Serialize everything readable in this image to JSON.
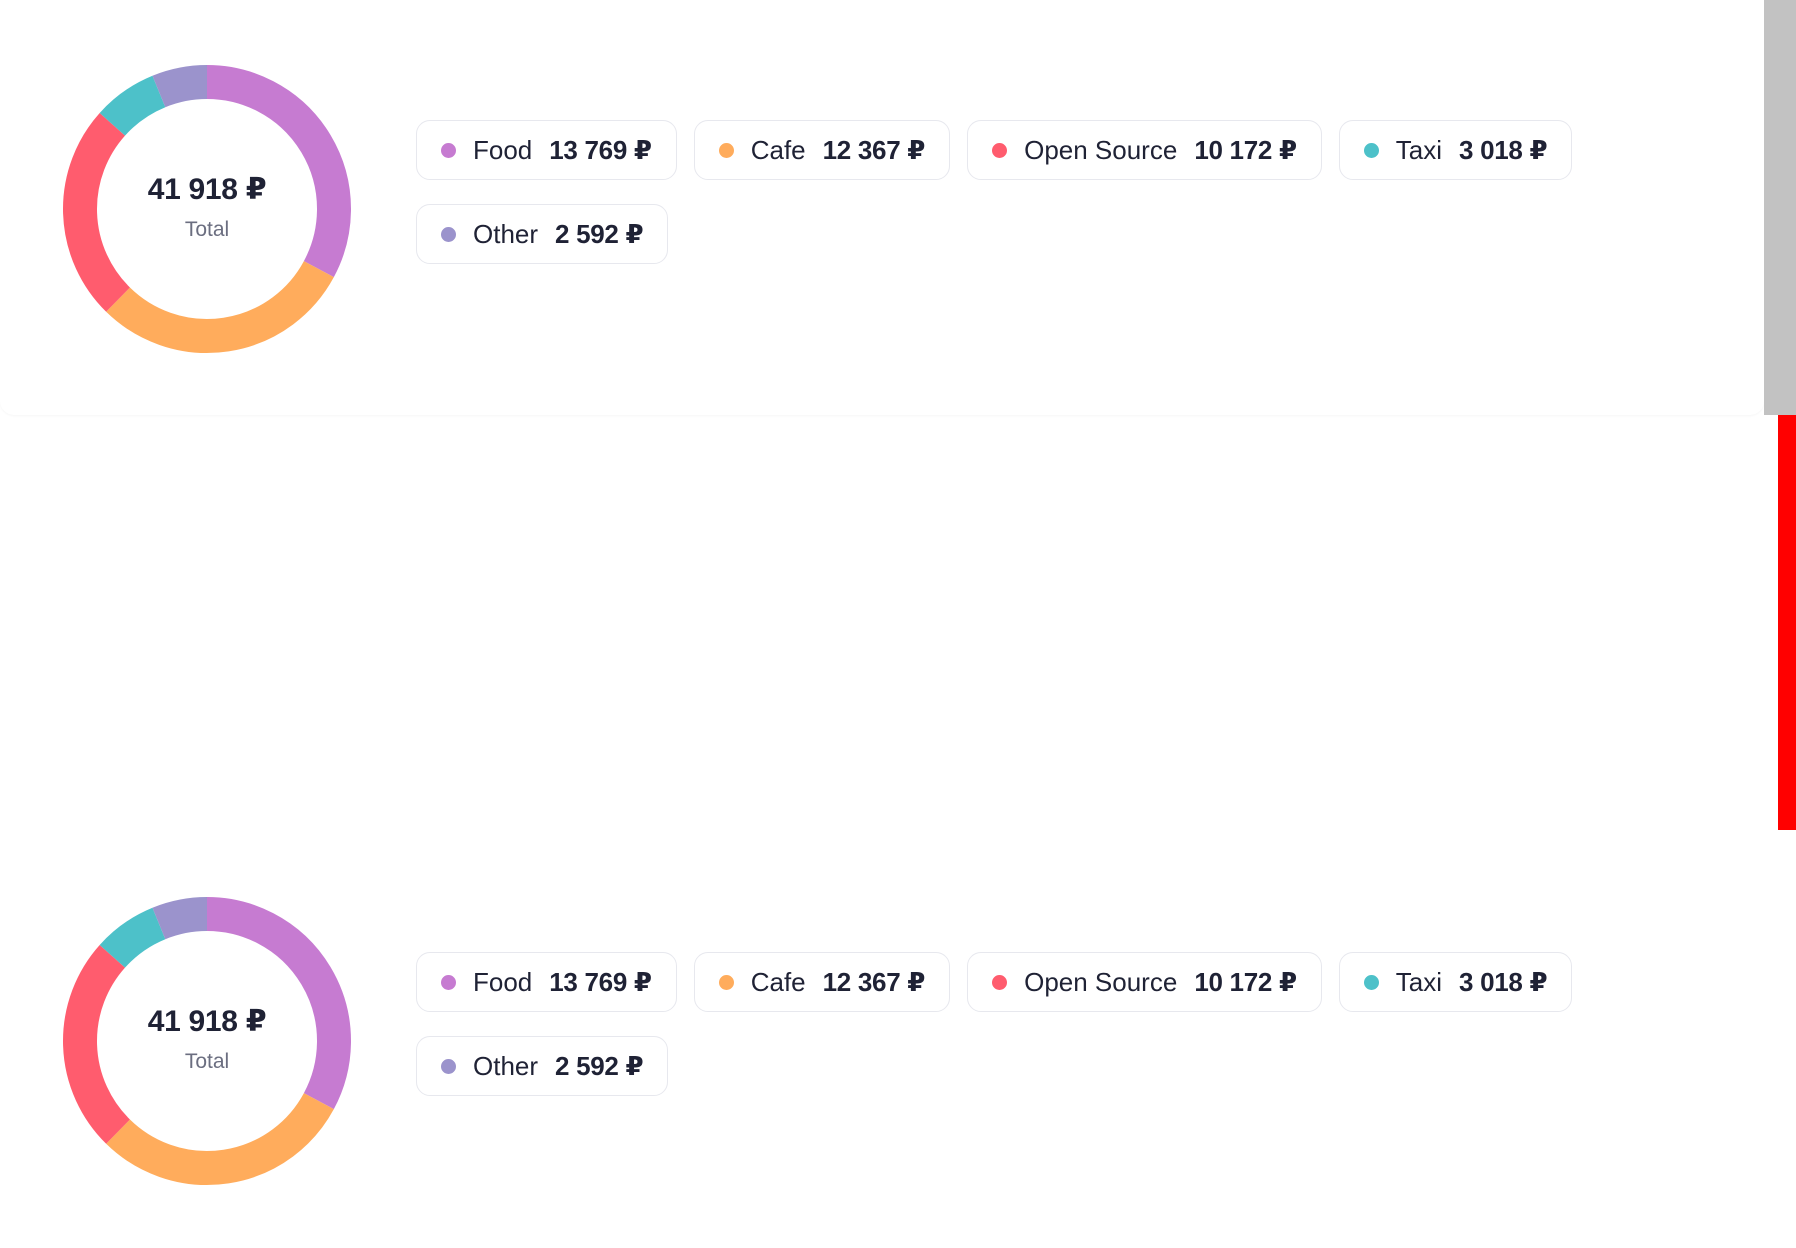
{
  "chart_data": [
    {
      "type": "pie",
      "total_value": "41 918 ₽",
      "total_label": "Total",
      "categories": [
        "Food",
        "Cafe",
        "Open Source",
        "Taxi",
        "Other"
      ],
      "values": [
        13769,
        12367,
        10172,
        3018,
        2592
      ],
      "value_labels": [
        "13 769 ₽",
        "12 367 ₽",
        "10 172 ₽",
        "3 018 ₽",
        "2 592 ₽"
      ],
      "colors": [
        "#c67bd1",
        "#ffac5c",
        "#ff5c6e",
        "#4dc1c9",
        "#9b93cc"
      ]
    },
    {
      "type": "pie",
      "total_value": "41 918 ₽",
      "total_label": "Total",
      "categories": [
        "Food",
        "Cafe",
        "Open Source",
        "Taxi",
        "Other"
      ],
      "values": [
        13769,
        12367,
        10172,
        3018,
        2592
      ],
      "value_labels": [
        "13 769 ₽",
        "12 367 ₽",
        "10 172 ₽",
        "3 018 ₽",
        "2 592 ₽"
      ],
      "colors": [
        "#c67bd1",
        "#ffac5c",
        "#ff5c6e",
        "#4dc1c9",
        "#9b93cc"
      ]
    }
  ]
}
